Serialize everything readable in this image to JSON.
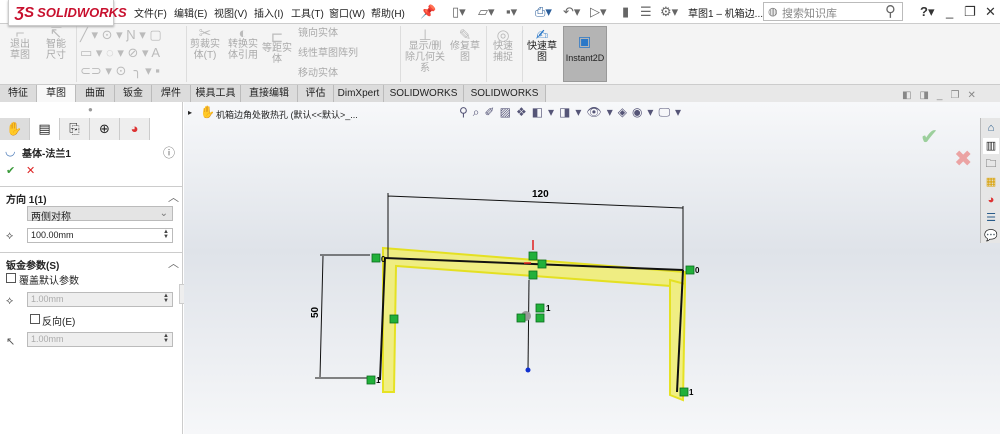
{
  "app": {
    "logo": "SOLIDWORKS",
    "document_title": "草图1 – 机箱边...",
    "search_placeholder": "搜索知识库"
  },
  "menu": [
    "文件(F)",
    "编辑(E)",
    "视图(V)",
    "插入(I)",
    "工具(T)",
    "窗口(W)",
    "帮助(H)"
  ],
  "ribbon": {
    "exit_sketch": "退出草图",
    "smart_dim": "智能尺寸",
    "trim": "剪裁实体(T)",
    "convert": "转换实体引用",
    "offset": "等距实体",
    "mirror": "镜向实体",
    "linear_pattern": "线性草图阵列",
    "move": "移动实体",
    "show_relations": "显示/删除几何关系",
    "repair": "修复草图",
    "quick_snap": "快速捕捉",
    "rapid_sketch": "快速草图",
    "instant2d": "Instant2D"
  },
  "tabs": [
    "特征",
    "草图",
    "曲面",
    "钣金",
    "焊件",
    "模具工具",
    "直接编辑",
    "评估",
    "DimXpert",
    "SOLIDWORKS 插件",
    "SOLIDWORKS MBD"
  ],
  "active_tab": "草图",
  "panel": {
    "feature_title": "基体-法兰1",
    "direction": {
      "label": "方向 1(1)",
      "type": "两侧对称",
      "depth": "100.00mm"
    },
    "sheet_metal": {
      "label": "钣金参数(S)",
      "override_label": "覆盖默认参数",
      "override": false,
      "thickness": "1.00mm",
      "reverse_label": "反向(E)",
      "reverse": false,
      "radius": "1.00mm"
    }
  },
  "tree": {
    "part_name": "机箱边角处散热孔 (默认<<默认>_..."
  },
  "sketch": {
    "dim_width": "120",
    "dim_height": "50",
    "relation_labels": [
      "0",
      "0",
      "1",
      "1",
      "1"
    ]
  }
}
